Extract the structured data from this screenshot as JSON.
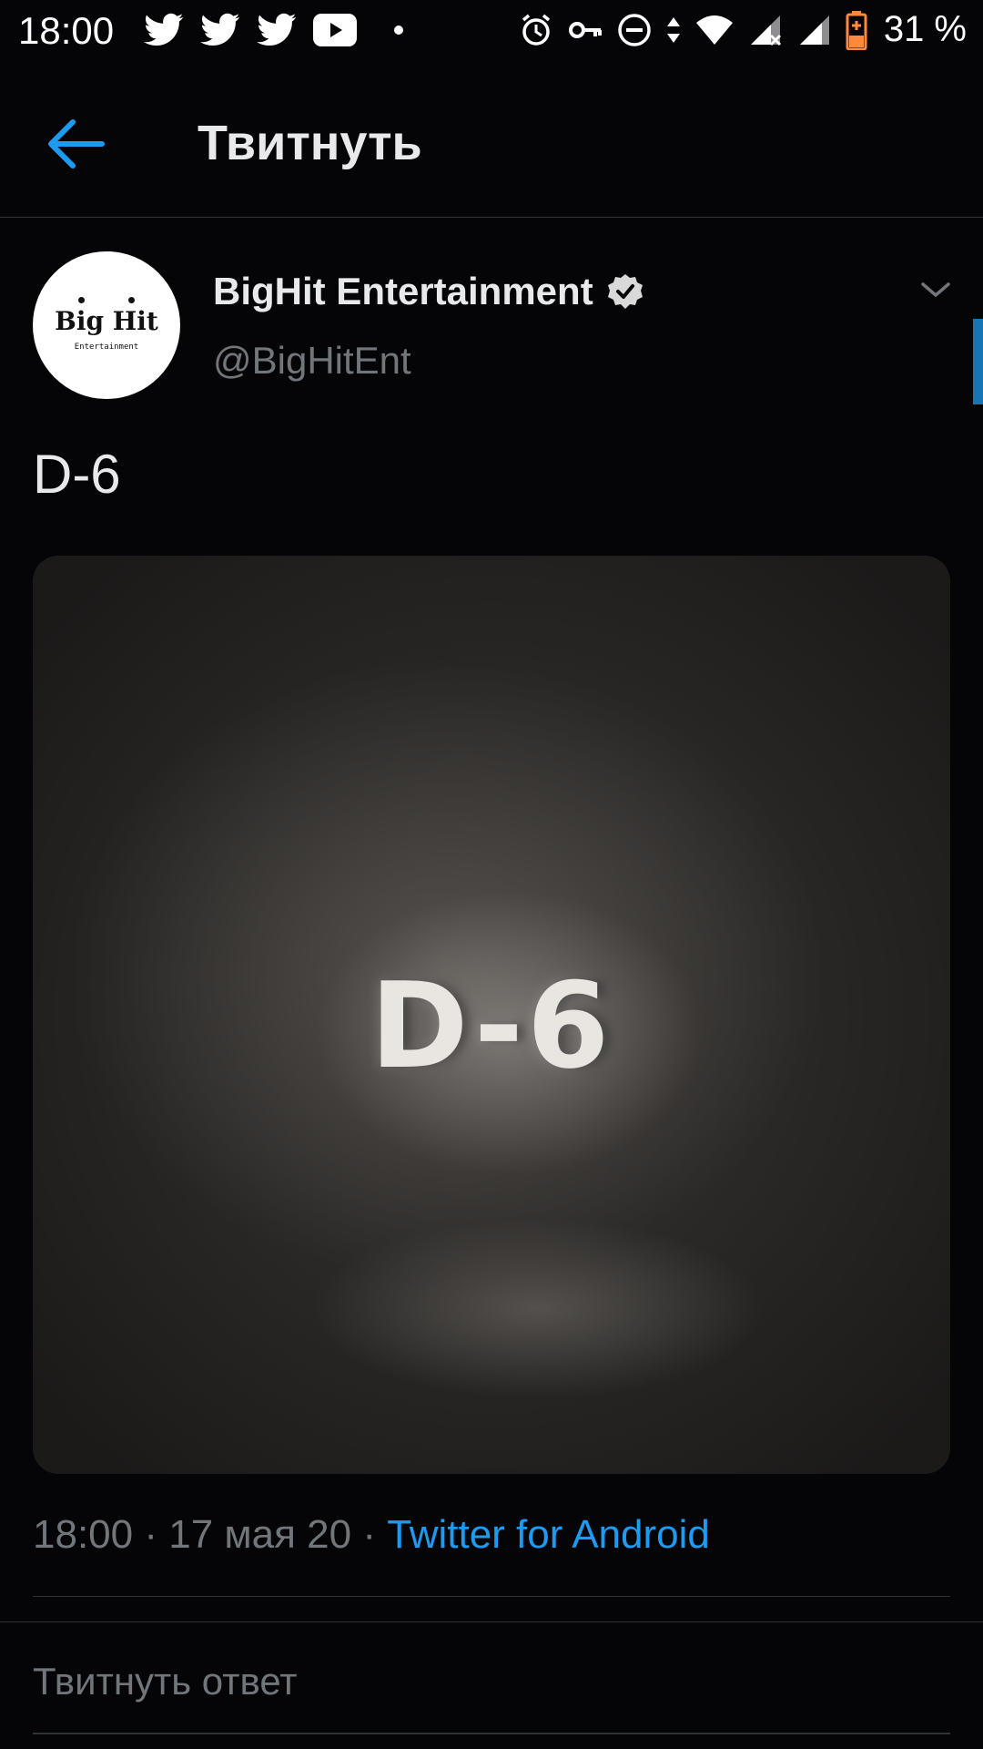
{
  "status_bar": {
    "time": "18:00",
    "notification_icons": [
      "twitter-icon",
      "twitter-icon",
      "twitter-icon",
      "youtube-icon",
      "dot-icon"
    ],
    "system_icons": [
      "alarm-icon",
      "vpn-key-icon",
      "do-not-disturb-icon",
      "data-arrows-icon",
      "wifi-icon",
      "signal-icon",
      "signal-icon"
    ],
    "battery_percent": "31 %",
    "battery_color": "#ff8a3d"
  },
  "header": {
    "back_icon": "arrow-left-icon",
    "title": "Твитнуть",
    "accent": "#1d9bf0"
  },
  "tweet": {
    "avatar": {
      "logo_main": "Big Hit",
      "logo_sub": "Entertainment"
    },
    "author_name": "BigHit Entertainment",
    "verified_icon": "verified-badge-icon",
    "handle": "@BigHitEnt",
    "text": "D-6",
    "media_text": "D-6",
    "time": "18:00",
    "separator": "·",
    "date": "17 мая 20",
    "source": "Twitter for Android"
  },
  "reply": {
    "placeholder": "Твитнуть ответ"
  }
}
